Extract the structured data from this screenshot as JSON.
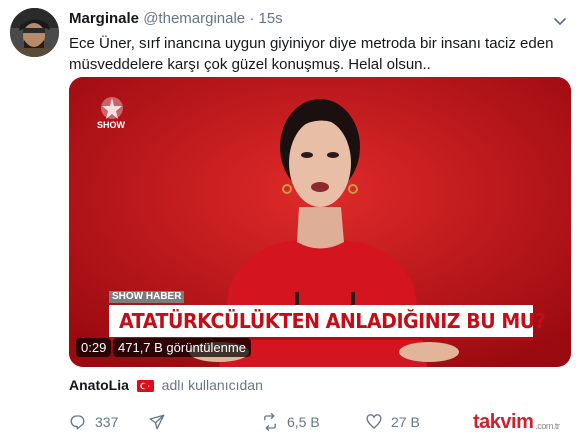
{
  "tweet": {
    "display_name": "Marginale",
    "handle": "@themarginale",
    "separator": "·",
    "time": "15s",
    "text": "Ece Üner, sırf inancına uygun giyiniyor diye metroda bir insanı taciz eden müsveddelere karşı çok güzel konuşmuş. Helal olsun.."
  },
  "media": {
    "channel_logo_text": "SHOW",
    "lower_third_tag": "SHOW",
    "lower_third_tag_suffix": "HABER",
    "headline": "ATATÜRKCÜLÜKTEN ANLADIĞINIZ BU MU?",
    "duration": "0:29",
    "views": "471,7 B görüntülenme",
    "colors": {
      "background": "#c8101a",
      "headline": "#c40d16"
    }
  },
  "source": {
    "name": "AnatoLia",
    "suffix": "adlı kullanıcıdan",
    "flag_icon": "turkey-flag-icon"
  },
  "actions": {
    "reply_count": "337",
    "retweet_count": "6,5 B",
    "like_count": "27 B"
  },
  "watermark": {
    "text": "takvim",
    "suffix": ".com.tr"
  }
}
